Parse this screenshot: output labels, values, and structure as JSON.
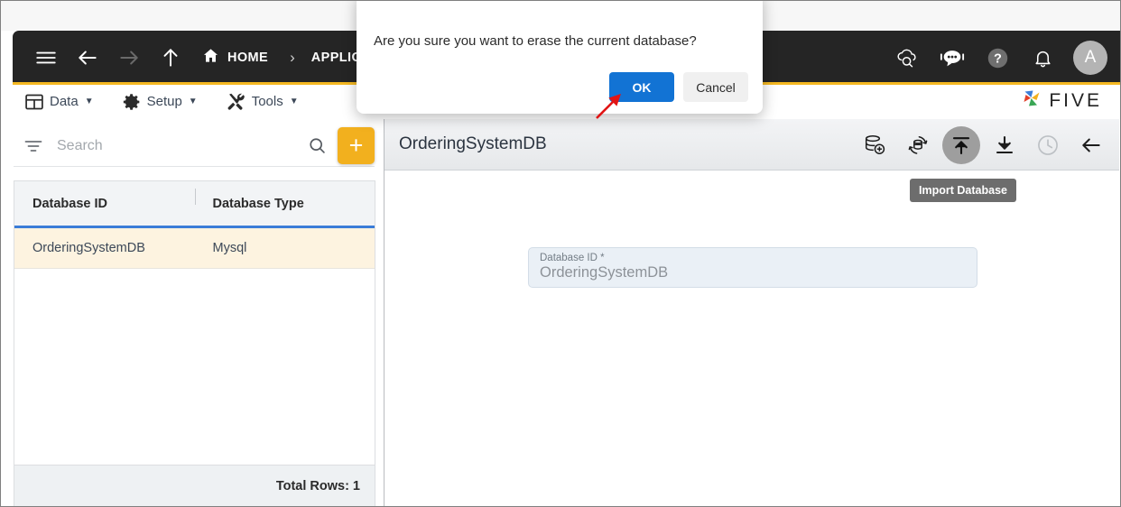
{
  "topbar": {
    "nav_buttons": [
      {
        "name": "menu-icon",
        "label": "Menu",
        "enabled": true
      },
      {
        "name": "back-icon",
        "label": "Back",
        "enabled": true
      },
      {
        "name": "forward-icon",
        "label": "Forward",
        "enabled": false
      },
      {
        "name": "up-icon",
        "label": "Up",
        "enabled": true
      }
    ],
    "breadcrumb": {
      "home_label": "HOME",
      "separator": "›",
      "items": [
        "APPLICATIO"
      ]
    },
    "right_icons": [
      {
        "name": "cloud-search-icon",
        "label": "Cloud Search"
      },
      {
        "name": "chat-bot-icon",
        "label": "Assistant"
      },
      {
        "name": "help-icon",
        "label": "Help"
      },
      {
        "name": "bell-icon",
        "label": "Notifications"
      }
    ],
    "avatar_initial": "A",
    "accent_color": "#f5b822",
    "bar_color": "#252525"
  },
  "menubar": {
    "items": [
      {
        "icon": "grid-icon",
        "label": "Data",
        "caret": "▼"
      },
      {
        "icon": "gear-icon",
        "label": "Setup",
        "caret": "▼"
      },
      {
        "icon": "tools-icon",
        "label": "Tools",
        "caret": "▼"
      }
    ],
    "logo_text": "FIVE"
  },
  "sidebar": {
    "search": {
      "placeholder": "Search",
      "value": "",
      "filter_icon": "filter-icon",
      "search_icon": "search-icon"
    },
    "add_button_label": "+",
    "grid": {
      "columns": [
        "Database ID",
        "Database Type"
      ],
      "rows": [
        {
          "database_id": "OrderingSystemDB",
          "database_type": "Mysql",
          "selected": true
        }
      ],
      "footer": "Total Rows: 1",
      "selected_row_color": "#fdf3e0",
      "header_underline_color": "#3b7dd8"
    }
  },
  "content": {
    "title": "OrderingSystemDB",
    "toolbar": [
      {
        "name": "add-database-icon",
        "label": "Add Database",
        "state": "normal"
      },
      {
        "name": "refresh-database-icon",
        "label": "Refresh Database",
        "state": "normal"
      },
      {
        "name": "import-database-icon",
        "label": "Import Database",
        "state": "active"
      },
      {
        "name": "export-database-icon",
        "label": "Export Database",
        "state": "normal"
      },
      {
        "name": "history-icon",
        "label": "History",
        "state": "disabled"
      },
      {
        "name": "back-arrow-icon",
        "label": "Back",
        "state": "normal"
      }
    ],
    "tooltip": "Import Database",
    "form": {
      "database_id": {
        "label": "Database ID *",
        "value": "OrderingSystemDB"
      }
    }
  },
  "dialog": {
    "message": "Are you sure you want to erase the current database?",
    "ok_label": "OK",
    "cancel_label": "Cancel",
    "ok_color": "#1273d4"
  },
  "annotation": {
    "arrow_color": "#e11414"
  }
}
